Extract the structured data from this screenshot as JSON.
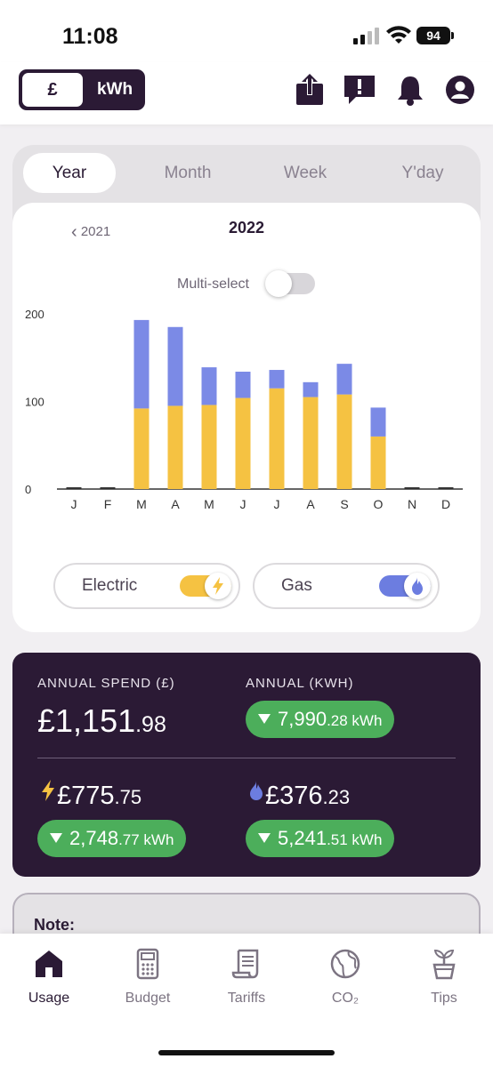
{
  "status": {
    "time": "11:08",
    "battery": "94"
  },
  "header": {
    "unit_options": [
      "£",
      "kWh"
    ],
    "selected_unit": "£",
    "icons": [
      "share-icon",
      "feedback-icon",
      "bell-icon",
      "profile-icon"
    ]
  },
  "period_tabs": {
    "items": [
      "Year",
      "Month",
      "Week",
      "Y'day"
    ],
    "selected": "Year"
  },
  "chart_header": {
    "prev_year": "2021",
    "current_year": "2022"
  },
  "multi_select": {
    "label": "Multi-select",
    "enabled": false
  },
  "chart_data": {
    "type": "bar",
    "stacked": true,
    "categories": [
      "J",
      "F",
      "M",
      "A",
      "M",
      "J",
      "J",
      "A",
      "S",
      "O",
      "N",
      "D"
    ],
    "series": [
      {
        "values": [
          0,
          0,
          92,
          95,
          96,
          104,
          115,
          105,
          108,
          60,
          0,
          0
        ],
        "color": "#f5c242"
      },
      {
        "values": [
          0,
          0,
          101,
          90,
          43,
          30,
          21,
          17,
          35,
          33,
          0,
          0
        ],
        "color": "#7b8ae6"
      }
    ],
    "yticks": [
      0,
      100,
      200
    ],
    "ylim": [
      0,
      200
    ],
    "grid": false
  },
  "fuel_toggles": {
    "electric": {
      "label": "Electric",
      "enabled": true,
      "color": "#f5c242",
      "icon": "lightning-icon"
    },
    "gas": {
      "label": "Gas",
      "enabled": true,
      "color": "#6c7de0",
      "icon": "flame-icon"
    }
  },
  "summary": {
    "annual_spend_label": "ANNUAL SPEND (£)",
    "annual_spend_main": "£1,151",
    "annual_spend_dec": ".98",
    "annual_kwh_label": "ANNUAL (KWH)",
    "annual_kwh_main": "7,990",
    "annual_kwh_dec": ".28 kWh",
    "electric_spend_main": "£775",
    "electric_spend_dec": ".75",
    "electric_kwh_main": "2,748",
    "electric_kwh_dec": ".77 kWh",
    "gas_spend_main": "£376",
    "gas_spend_dec": ".23",
    "gas_kwh_main": "5,241",
    "gas_kwh_dec": ".51 kWh",
    "positive_color": "#4cae5b"
  },
  "note": {
    "label": "Note:"
  },
  "bottom_nav": {
    "items": [
      {
        "label": "Usage",
        "icon": "home-icon"
      },
      {
        "label": "Budget",
        "icon": "calculator-icon"
      },
      {
        "label": "Tariffs",
        "icon": "receipt-icon"
      },
      {
        "label": "CO₂",
        "icon": "globe-icon"
      },
      {
        "label": "Tips",
        "icon": "plant-icon"
      }
    ],
    "selected": "Usage"
  }
}
